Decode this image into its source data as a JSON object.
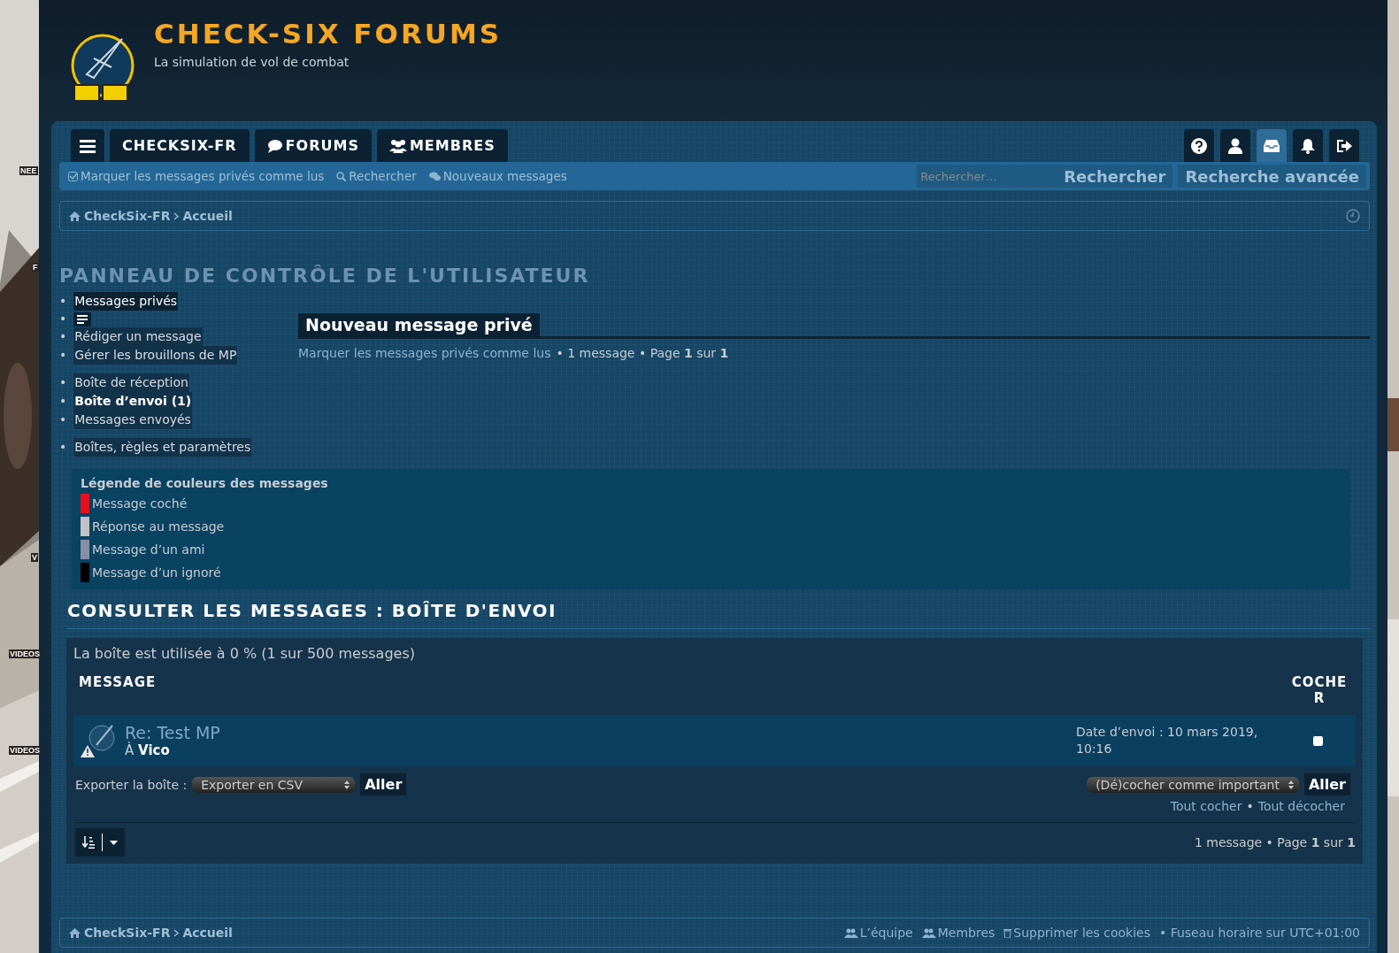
{
  "site": {
    "title": "CHECK-SIX FORUMS",
    "tagline": "La simulation de vol de combat"
  },
  "backdrop_labels": [
    "NEE",
    "F",
    "V",
    "VIDEOS",
    "VIDEOS"
  ],
  "nav_tabs": [
    {
      "label": "CHECKSIX-FR",
      "kind": "plain"
    },
    {
      "label": "FORUMS",
      "kind": "forums"
    },
    {
      "label": "MEMBRES",
      "kind": "members"
    }
  ],
  "toolbar_buttons": [
    {
      "kind": "help",
      "selected": false
    },
    {
      "kind": "user",
      "selected": false
    },
    {
      "kind": "inbox",
      "selected": true
    },
    {
      "kind": "bell",
      "selected": false
    },
    {
      "kind": "logout",
      "selected": false
    }
  ],
  "subnav": {
    "links": [
      {
        "label": "Marquer les messages privés comme lus",
        "kind": "check"
      },
      {
        "label": "Rechercher",
        "kind": "search"
      },
      {
        "label": "Nouveaux messages",
        "kind": "chat"
      }
    ],
    "search_placeholder": "Rechercher…",
    "search_button": "Rechercher",
    "advanced_button": "Recherche avancée"
  },
  "breadcrumb": [
    "CheckSix-FR",
    "Accueil"
  ],
  "panel_title": "PANNEAU DE CONTRÔLE DE L'UTILISATEUR",
  "menu": {
    "bullet": "•",
    "title": "Messages privés",
    "groups": [
      {
        "items": [
          {
            "label": "Rédiger un message",
            "selected": false
          },
          {
            "label": "Gérer les brouillons de MP",
            "selected": false
          }
        ]
      },
      {
        "items": [
          {
            "label": "Boîte de réception",
            "selected": false
          },
          {
            "label": "Boîte d’envoi (1)",
            "selected": true
          },
          {
            "label": "Messages envoyés",
            "selected": false
          }
        ]
      },
      {
        "items": [
          {
            "label": "Boîtes, règles et paramètres",
            "selected": false
          }
        ]
      }
    ]
  },
  "compose": {
    "title": "Nouveau message privé",
    "mark_read": "Marquer les messages privés comme lus",
    "pagination": "• 1 message • Page **1** sur **1**"
  },
  "legend": {
    "title": "Légende de couleurs des messages",
    "items": [
      {
        "label": "Message coché",
        "color": "#e8101c"
      },
      {
        "label": "Réponse au message",
        "color": "#c0c2c5"
      },
      {
        "label": "Message d’un ami",
        "color": "#8890a6"
      },
      {
        "label": "Message d’un ignoré",
        "color": "#000000"
      }
    ]
  },
  "folder": {
    "title": "CONSULTER LES MESSAGES : BOÎTE D'ENVOI",
    "usage": "La boîte est utilisée à 0 % (1 sur 500 messages)",
    "columns": [
      "MESSAGE",
      "COCHER"
    ],
    "messages": [
      {
        "subject": "Re: Test MP",
        "to_prefix": "À",
        "recipient": "Vico",
        "date": "Date d’envoi : 10 mars 2019, 10:16",
        "checked": false
      }
    ],
    "export_label": "Exporter la boîte :",
    "export_option": "Exporter en CSV",
    "go": "Aller",
    "mark_option": "(Dé)cocher comme important",
    "go2": "Aller",
    "check_all": "Tout cocher",
    "separator": "•",
    "uncheck_all": "Tout décocher",
    "pagination": "1 message • Page **1** sur **1**"
  },
  "footer": {
    "breadcrumb": [
      "CheckSix-FR",
      "Accueil"
    ],
    "links": [
      {
        "label": "L’équipe",
        "kind": "team"
      },
      {
        "label": "Membres",
        "kind": "team"
      },
      {
        "label": "Supprimer les cookies",
        "kind": "trash"
      }
    ],
    "timezone": "• Fuseau horaire sur UTC+01:00"
  }
}
